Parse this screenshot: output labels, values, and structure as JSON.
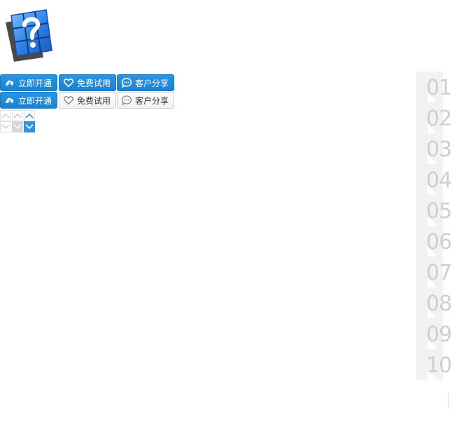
{
  "logo": {
    "icon": "help-question-icon"
  },
  "buttons": {
    "row1": {
      "open_now": {
        "label": "立即开通",
        "icon": "cloud-icon"
      },
      "free_trial": {
        "label": "免费试用",
        "icon": "heart-icon"
      },
      "customer_share": {
        "label": "客户分享",
        "icon": "chat-bubble-icon"
      }
    },
    "row2": {
      "open_now": {
        "label": "立即开通",
        "icon": "cloud-icon"
      },
      "free_trial": {
        "label": "免费试用",
        "icon": "heart-icon"
      },
      "customer_share": {
        "label": "客户分享",
        "icon": "chat-bubble-icon"
      }
    }
  },
  "arrows": {
    "up": [
      "chevron-up-icon",
      "chevron-up-icon",
      "chevron-up-icon"
    ],
    "down": [
      "chevron-down-icon",
      "chevron-down-icon",
      "chevron-down-icon"
    ]
  },
  "numbers": [
    "01",
    "02",
    "03",
    "04",
    "05",
    "06",
    "07",
    "08",
    "09",
    "10"
  ],
  "colors": {
    "primary": "#2a95e2",
    "gray_arrow": "#d6d6d6",
    "number_text": "#cfcfcf",
    "number_tab": "#f2f2f2"
  }
}
